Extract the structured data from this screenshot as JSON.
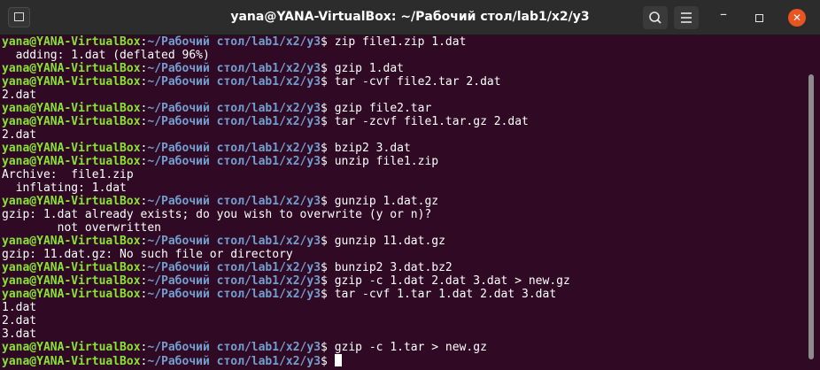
{
  "window": {
    "title": "yana@YANA-VirtualBox: ~/Рабочий стол/lab1/x2/y3"
  },
  "prompt": {
    "user_host": "yana@YANA-VirtualBox",
    "sep": ":",
    "path": "~/Рабочий стол/lab1/x2/y3",
    "dollar": "$ "
  },
  "lines": [
    {
      "type": "cmd",
      "text": "zip file1.zip 1.dat"
    },
    {
      "type": "out",
      "text": "  adding: 1.dat (deflated 96%)"
    },
    {
      "type": "cmd",
      "text": "gzip 1.dat"
    },
    {
      "type": "cmd",
      "text": "tar -cvf file2.tar 2.dat"
    },
    {
      "type": "out",
      "text": "2.dat"
    },
    {
      "type": "cmd",
      "text": "gzip file2.tar"
    },
    {
      "type": "cmd",
      "text": "tar -zcvf file1.tar.gz 2.dat"
    },
    {
      "type": "out",
      "text": "2.dat"
    },
    {
      "type": "cmd",
      "text": "bzip2 3.dat"
    },
    {
      "type": "cmd",
      "text": "unzip file1.zip"
    },
    {
      "type": "out",
      "text": "Archive:  file1.zip"
    },
    {
      "type": "out",
      "text": "  inflating: 1.dat"
    },
    {
      "type": "cmd",
      "text": "gunzip 1.dat.gz"
    },
    {
      "type": "out",
      "text": "gzip: 1.dat already exists; do you wish to overwrite (y or n)? "
    },
    {
      "type": "out",
      "text": "\tnot overwritten"
    },
    {
      "type": "cmd",
      "text": "gunzip 11.dat.gz"
    },
    {
      "type": "out",
      "text": "gzip: 11.dat.gz: No such file or directory"
    },
    {
      "type": "cmd",
      "text": "bunzip2 3.dat.bz2"
    },
    {
      "type": "cmd",
      "text": "gzip -c 1.dat 2.dat 3.dat > new.gz"
    },
    {
      "type": "cmd",
      "text": "tar -cvf 1.tar 1.dat 2.dat 3.dat"
    },
    {
      "type": "out",
      "text": "1.dat"
    },
    {
      "type": "out",
      "text": "2.dat"
    },
    {
      "type": "out",
      "text": "3.dat"
    },
    {
      "type": "cmd",
      "text": "gzip -c 1.tar > new.gz"
    },
    {
      "type": "cmd",
      "text": "",
      "cursor": true
    }
  ],
  "icons": {
    "new_tab": "new-tab-icon",
    "search": "search-icon",
    "menu": "hamburger-menu-icon",
    "minimize": "minimize-icon",
    "maximize": "maximize-icon",
    "close": "close-icon"
  },
  "colors": {
    "background": "#300a24",
    "titlebar": "#2c2c2c",
    "user_host": "#8ae234",
    "path": "#729fcf",
    "text": "#ffffff",
    "close": "#e95420"
  }
}
